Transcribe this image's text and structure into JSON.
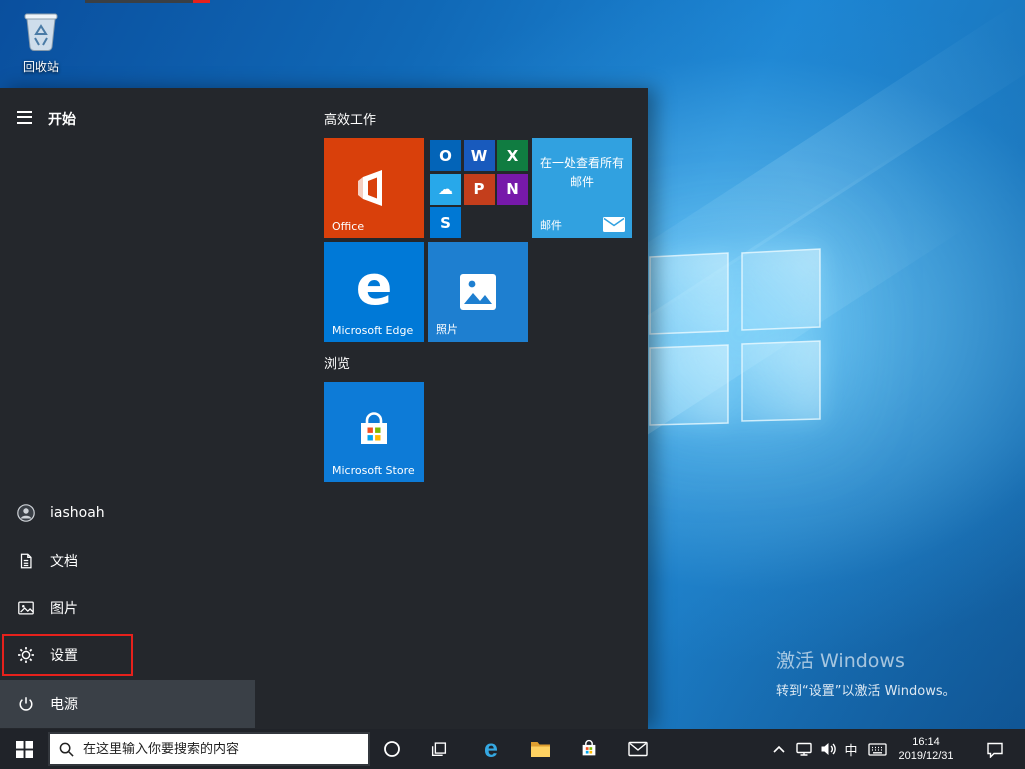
{
  "desktop": {
    "recycle_bin_label": "回收站",
    "activation_title": "激活 Windows",
    "activation_sub": "转到“设置”以激活 Windows。"
  },
  "start_menu": {
    "title": "开始",
    "group_productivity": "高效工作",
    "group_explore": "浏览",
    "rail": {
      "user": "iashoah",
      "documents": "文档",
      "pictures": "图片",
      "settings": "设置",
      "power": "电源"
    },
    "tiles": {
      "office": {
        "label": "Office",
        "color": "#d9400b"
      },
      "office_group_small": [
        {
          "glyph": "O",
          "color": "#0364b8"
        },
        {
          "glyph": "W",
          "color": "#185abd"
        },
        {
          "glyph": "X",
          "color": "#107c41"
        },
        {
          "glyph": "☁",
          "color": "#28a8ea"
        },
        {
          "glyph": "P",
          "color": "#c43e1c"
        },
        {
          "glyph": "N",
          "color": "#7719aa"
        },
        {
          "glyph": "S",
          "color": "#0078d4"
        }
      ],
      "mail": {
        "headline": "在一处查看所有邮件",
        "label": "邮件",
        "color": "#31a1e0"
      },
      "edge": {
        "label": "Microsoft Edge",
        "glyph": "e",
        "color": "#0079d7"
      },
      "photos": {
        "label": "照片",
        "color": "#1e7fd0"
      },
      "store": {
        "label": "Microsoft Store",
        "color": "#0d7bd7"
      }
    }
  },
  "taskbar": {
    "search_placeholder": "在这里输入你要搜索的内容",
    "edge_glyph": "e",
    "ime": "中",
    "time": "16:14",
    "date": "2019/12/31"
  },
  "colors": {
    "accent": "#0078d7",
    "highlight_red": "#e6211c",
    "edge_blue": "#35a8e2",
    "folder_front": "#ffd262",
    "folder_back": "#df9f30",
    "win_flag_red": "#f25022",
    "win_flag_green": "#7fba00",
    "win_flag_blue": "#00a4ef",
    "win_flag_yellow": "#ffb900"
  }
}
